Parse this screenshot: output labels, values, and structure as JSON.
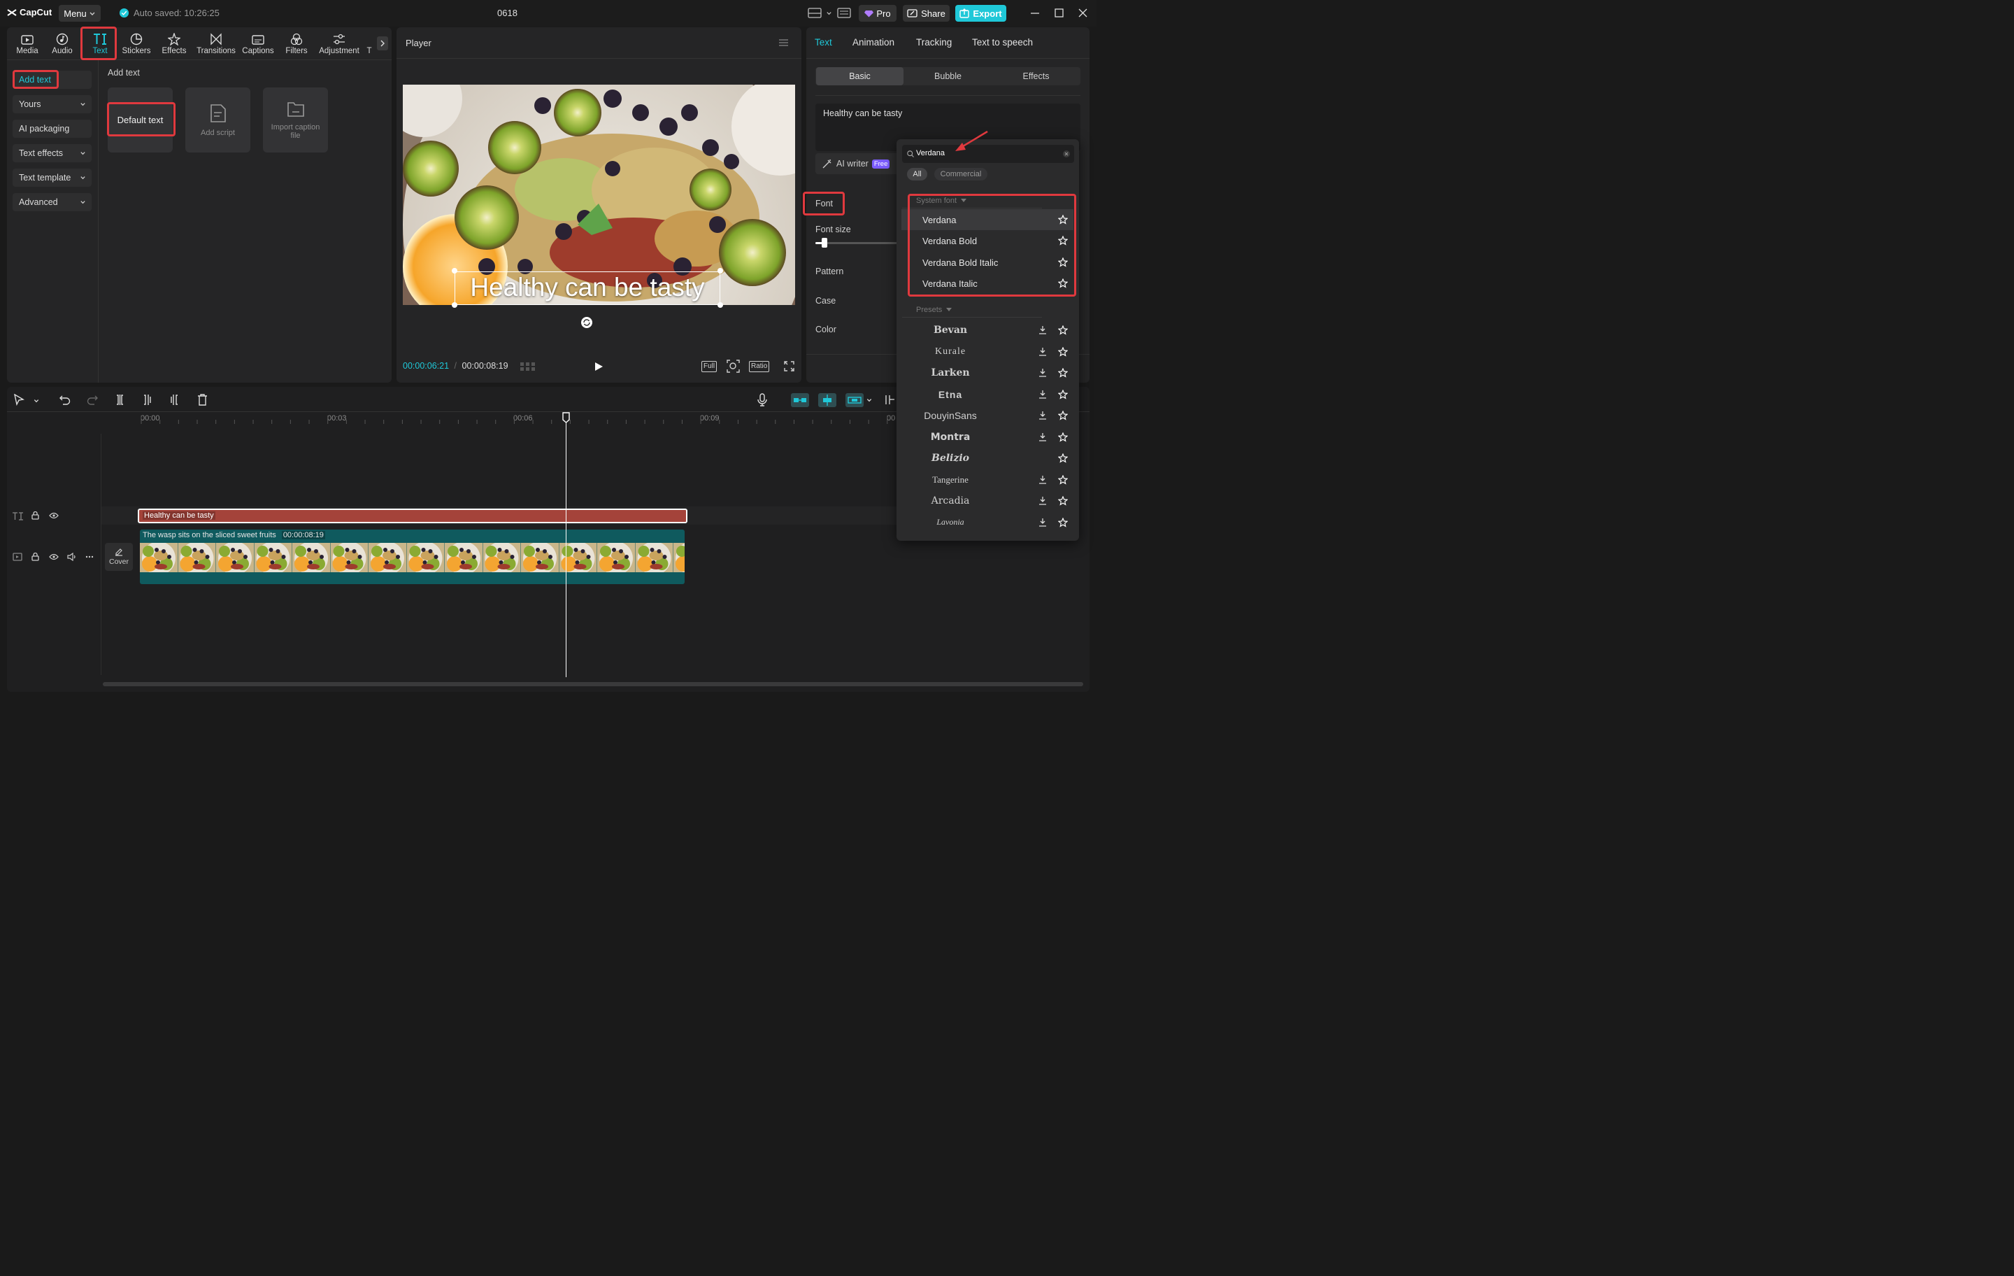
{
  "app": {
    "logo": "CapCut",
    "menu_label": "Menu",
    "autosave": "Auto saved: 10:26:25",
    "project_title": "0618",
    "pro_label": "Pro",
    "share_label": "Share",
    "export_label": "Export"
  },
  "toolbar": {
    "tabs": [
      {
        "label": "Media",
        "icon": "media-icon"
      },
      {
        "label": "Audio",
        "icon": "audio-icon"
      },
      {
        "label": "Text",
        "icon": "text-icon"
      },
      {
        "label": "Stickers",
        "icon": "sticker-icon"
      },
      {
        "label": "Effects",
        "icon": "effects-icon"
      },
      {
        "label": "Transitions",
        "icon": "transition-icon"
      },
      {
        "label": "Captions",
        "icon": "captions-icon"
      },
      {
        "label": "Filters",
        "icon": "filters-icon"
      },
      {
        "label": "Adjustment",
        "icon": "adjustment-icon"
      },
      {
        "label": "T",
        "icon": "more-icon"
      }
    ]
  },
  "text_panel": {
    "sidebar": [
      {
        "label": "Add text"
      },
      {
        "label": "Yours"
      },
      {
        "label": "AI packaging"
      },
      {
        "label": "Text effects"
      },
      {
        "label": "Text template"
      },
      {
        "label": "Advanced"
      }
    ],
    "section_title": "Add text",
    "cards": [
      {
        "label": "Default text"
      },
      {
        "label": "Add script"
      },
      {
        "label": "Import caption file"
      }
    ]
  },
  "player": {
    "title": "Player",
    "overlay_text": "Healthy can be tasty",
    "current_time": "00:00:06:21",
    "total_time": "00:00:08:19",
    "full_label": "Full",
    "ratio_label": "Ratio"
  },
  "inspector": {
    "tabs": [
      "Text",
      "Animation",
      "Tracking",
      "Text to speech"
    ],
    "subtabs": [
      "Basic",
      "Bubble",
      "Effects"
    ],
    "text_value": "Healthy can be tasty",
    "ai_writer": "AI writer",
    "free_badge": "Free",
    "props": [
      "Font",
      "Font size",
      "Pattern",
      "Case",
      "Color"
    ]
  },
  "font_dropdown": {
    "search_value": "Verdana",
    "filters": [
      "All",
      "Commercial"
    ],
    "system_header": "System font",
    "system_fonts": [
      "Verdana",
      "Verdana Bold",
      "Verdana Bold Italic",
      "Verdana Italic"
    ],
    "presets_header": "Presets",
    "presets": [
      "Bevan",
      "Kurale",
      "Larken",
      "Etna",
      "DouyinSans",
      "Montra",
      "Belizio",
      "Tangerine",
      "Arcadia",
      "Lavonia"
    ]
  },
  "timeline": {
    "ticks": [
      "00:00",
      "00:03",
      "00:06",
      "00:09",
      "00"
    ],
    "text_clip": "Healthy can be tasty",
    "video_clip_label": "The wasp sits on the sliced sweet fruits",
    "video_clip_duration": "00:00:08:19",
    "cover_label": "Cover"
  },
  "colors": {
    "accent": "#1fc8d8",
    "highlight": "#e0393e",
    "text_clip": "#a4433a",
    "video_clip": "#0f5a5e"
  }
}
